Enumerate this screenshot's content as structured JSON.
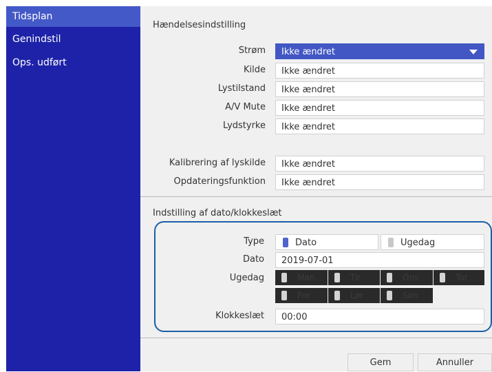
{
  "sidebar": {
    "items": [
      {
        "label": "Tidsplan",
        "active": true
      },
      {
        "label": "Genindstil",
        "active": false
      },
      {
        "label": "Ops. udført",
        "active": false
      }
    ]
  },
  "event_settings": {
    "title": "Hændelsesindstilling",
    "rows": [
      {
        "label": "Strøm",
        "value": "Ikke ændret"
      },
      {
        "label": "Kilde",
        "value": "Ikke ændret"
      },
      {
        "label": "Lystilstand",
        "value": "Ikke ændret"
      },
      {
        "label": "A/V Mute",
        "value": "Ikke ændret"
      },
      {
        "label": "Lydstyrke",
        "value": "Ikke ændret"
      },
      {
        "label": "Kalibrering af lyskilde",
        "value": "Ikke ændret"
      },
      {
        "label": "Opdateringsfunktion",
        "value": "Ikke ændret"
      }
    ]
  },
  "datetime": {
    "title": "Indstilling af dato/klokkeslæt",
    "type_label": "Type",
    "type_options": [
      "Dato",
      "Ugedag"
    ],
    "selected_type": "Dato",
    "date_label": "Dato",
    "date_value": "2019-07-01",
    "weekday_label": "Ugedag",
    "weekdays": [
      "Man",
      "Tir",
      "Ons",
      "Tor",
      "Fre",
      "Lør",
      "Søn"
    ],
    "time_label": "Klokkeslæt",
    "time_value": "00:00"
  },
  "footer": {
    "save_label": "Gem",
    "cancel_label": "Annuller"
  },
  "colors": {
    "sidebar_bg": "#1e22a8",
    "sidebar_active": "#4459c8",
    "selected_field": "#4257c4",
    "focus_frame": "#1a5fa8"
  }
}
